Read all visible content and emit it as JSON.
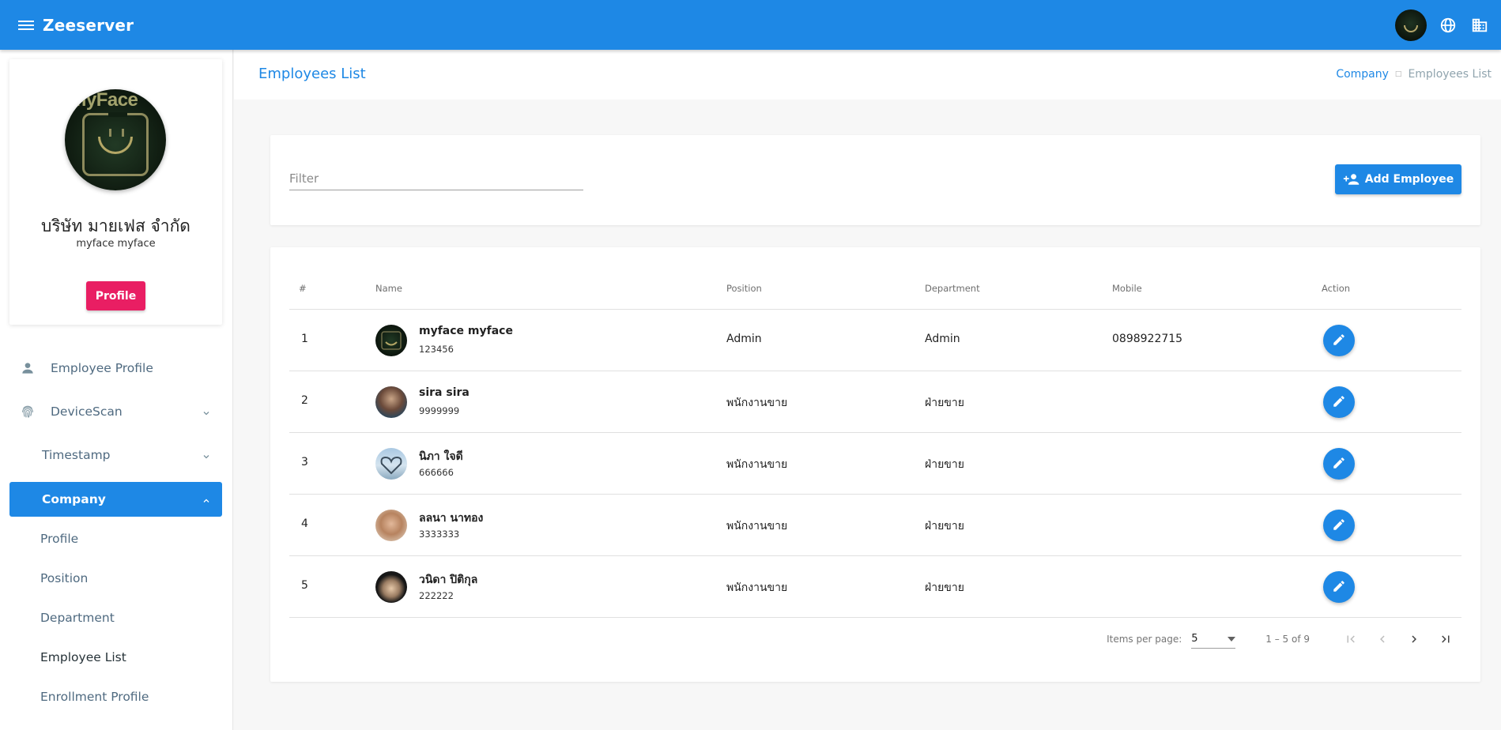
{
  "app": {
    "title": "Zeeserver"
  },
  "sidebar": {
    "company_name": "บริษัท มายเฟส จำกัด",
    "company_sub": "myface myface",
    "avatar_text": "myFace",
    "profile_button": "Profile",
    "nav": [
      {
        "label": "Employee Profile",
        "icon": "person-icon"
      },
      {
        "label": "DeviceScan",
        "icon": "fingerprint-icon",
        "expandable": true
      },
      {
        "label": "Timestamp",
        "expandable": true
      },
      {
        "label": "Company",
        "expandable": true,
        "expanded": true,
        "active": true
      },
      {
        "label": "Profile"
      },
      {
        "label": "Position"
      },
      {
        "label": "Department"
      },
      {
        "label": "Employee List",
        "current": true
      },
      {
        "label": "Enrollment Profile"
      }
    ]
  },
  "page": {
    "title": "Employees List",
    "breadcrumb": {
      "parent": "Company",
      "current": "Employees List"
    }
  },
  "filter": {
    "placeholder": "Filter",
    "value": ""
  },
  "add_button": {
    "label": "Add Employee",
    "icon": "person-add-icon"
  },
  "table": {
    "columns": [
      "#",
      "Name",
      "Position",
      "Department",
      "Mobile",
      "Action"
    ],
    "rows": [
      {
        "no": "1",
        "name": "myface myface",
        "code": "123456",
        "position": "Admin",
        "department": "Admin",
        "mobile": "0898922715"
      },
      {
        "no": "2",
        "name": "sira sira",
        "code": "9999999",
        "position": "พนักงานขาย",
        "department": "ฝ่ายขาย",
        "mobile": ""
      },
      {
        "no": "3",
        "name": "นิภา ใจดี",
        "code": "666666",
        "position": "พนักงานขาย",
        "department": "ฝ่ายขาย",
        "mobile": ""
      },
      {
        "no": "4",
        "name": "ลลนา นาทอง",
        "code": "3333333",
        "position": "พนักงานขาย",
        "department": "ฝ่ายขาย",
        "mobile": ""
      },
      {
        "no": "5",
        "name": "วนิดา ปิติกุล",
        "code": "222222",
        "position": "พนักงานขาย",
        "department": "ฝ่ายขาย",
        "mobile": ""
      }
    ]
  },
  "paginator": {
    "items_per_page_label": "Items per page:",
    "items_per_page": "5",
    "range": "1 – 5 of 9"
  },
  "colors": {
    "primary": "#1e88e5",
    "accent": "#e91e63"
  }
}
